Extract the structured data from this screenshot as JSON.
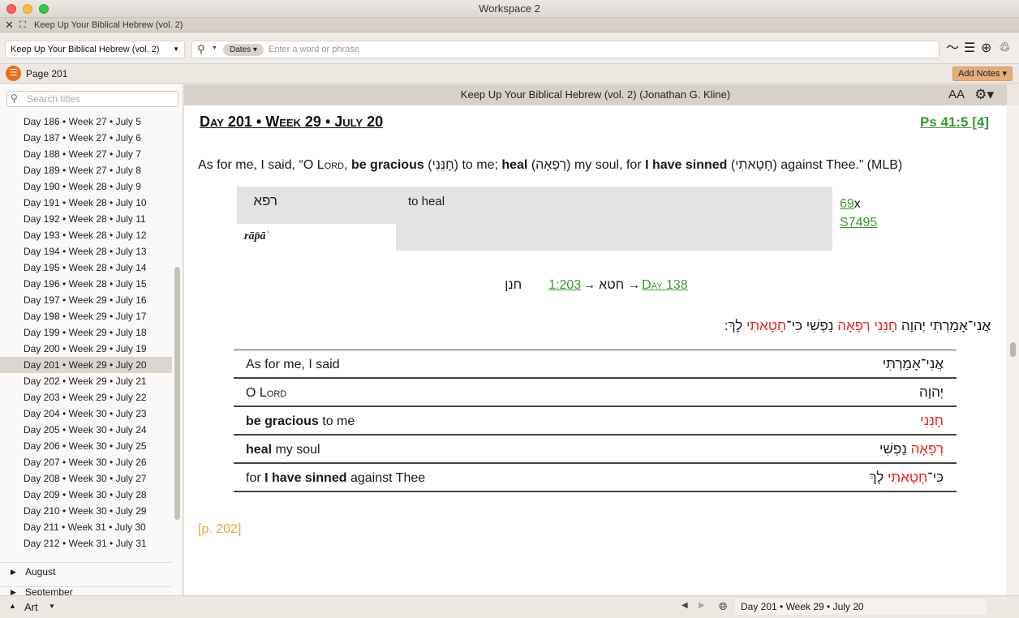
{
  "window": {
    "title": "Workspace 2",
    "tab_title": "Keep Up Your Biblical Hebrew (vol. 2)"
  },
  "toolbar": {
    "resource": "Keep Up Your Biblical Hebrew (vol. 2)",
    "search_filter": "Dates",
    "search_placeholder": "Enter a word or phrase"
  },
  "pagebar": {
    "page": "Page 201",
    "add_notes": "Add Notes"
  },
  "sidebar": {
    "search_placeholder": "Search titles",
    "days": [
      "Day 186 • Week 27 • July 5",
      "Day 187 • Week 27 • July 6",
      "Day 188 • Week 27 • July 7",
      "Day 189 • Week 27 • July 8",
      "Day 190 • Week 28 • July 9",
      "Day 191 • Week 28 • July 10",
      "Day 192 • Week 28 • July 11",
      "Day 193 • Week 28 • July 12",
      "Day 194 • Week 28 • July 13",
      "Day 195 • Week 28 • July 14",
      "Day 196 • Week 28 • July 15",
      "Day 197 • Week 29 • July 16",
      "Day 198 • Week 29 • July 17",
      "Day 199 • Week 29 • July 18",
      "Day 200 • Week 29 • July 19",
      "Day 201 • Week 29 • July 20",
      "Day 202 • Week 29 • July 21",
      "Day 203 • Week 29 • July 22",
      "Day 204 • Week 30 • July 23",
      "Day 205 • Week 30 • July 24",
      "Day 206 • Week 30 • July 25",
      "Day 207 • Week 30 • July 26",
      "Day 208 • Week 30 • July 27",
      "Day 209 • Week 30 • July 28",
      "Day 210 • Week 30 • July 29",
      "Day 211 • Week 31 • July 30",
      "Day 212 • Week 31 • July 31"
    ],
    "selected_index": 15,
    "month_1": "August",
    "month_2": "September"
  },
  "bottombar": {
    "panel": "Art",
    "reference": "Day 201 • Week 29 • July 20"
  },
  "content": {
    "header": "Keep Up Your Biblical Hebrew (vol. 2) (Jonathan G. Kline)",
    "aa": "AA",
    "day_title": "Day 201 • Week 29 • July 20",
    "ref_link": "Ps 41:5 [4]",
    "verse": {
      "p1": "As for me, I said, “O ",
      "lord": "Lord",
      "p2": ", ",
      "b1": "be gracious",
      "p3": " (חָנֵּנִי) to me; ",
      "b2": "heal",
      "p4": " (רְפָאָה) my soul, for ",
      "b3": "I have sinned",
      "p5": " (חָטָאתִי) against Thee.” (MLB)"
    },
    "lexicon": {
      "hebrew": "רפא",
      "gloss": "to heal",
      "translit": "rāp̄āʾ",
      "count": "69",
      "count_suffix": "x",
      "strongs": "S7495"
    },
    "xrefs": [
      {
        "hebrew": "חטא",
        "link": "1:203"
      },
      {
        "hebrew": "חנן",
        "link": "Day 138"
      }
    ],
    "hebrew_verse": {
      "a": "אֲנִי־אָמַרְתִּי יְהוָה ",
      "r1": "חָנֵּנִי רְפָאָה",
      "b": " נַפְשִׁי כִּי־",
      "r2": "חָטָאתִי",
      "c": " לָךְ ׃"
    },
    "phrases": [
      {
        "en_pre": "",
        "en_bold": "",
        "en_post": "As for me, I said",
        "he_black": "אֲנִי־אָמַרְתִּי",
        "he_red": ""
      },
      {
        "en_pre": "O ",
        "en_bold": "",
        "en_post": "Lord",
        "he_black": "יְהוָה",
        "he_red": ""
      },
      {
        "en_pre": "",
        "en_bold": "be gracious",
        "en_post": " to me",
        "he_black": "",
        "he_red": "חָנֵּנִי"
      },
      {
        "en_pre": "",
        "en_bold": "heal",
        "en_post": " my soul",
        "he_black": " נַפְשִׁי",
        "he_red": "רְפָאָה"
      },
      {
        "en_pre": "for ",
        "en_bold": "I have sinned",
        "en_post": " against Thee",
        "he_black": "כִּי־",
        "he_red": "חָטָאתִי",
        "he_tail": " לָךְ"
      }
    ],
    "page_number": "[p. 202]"
  }
}
